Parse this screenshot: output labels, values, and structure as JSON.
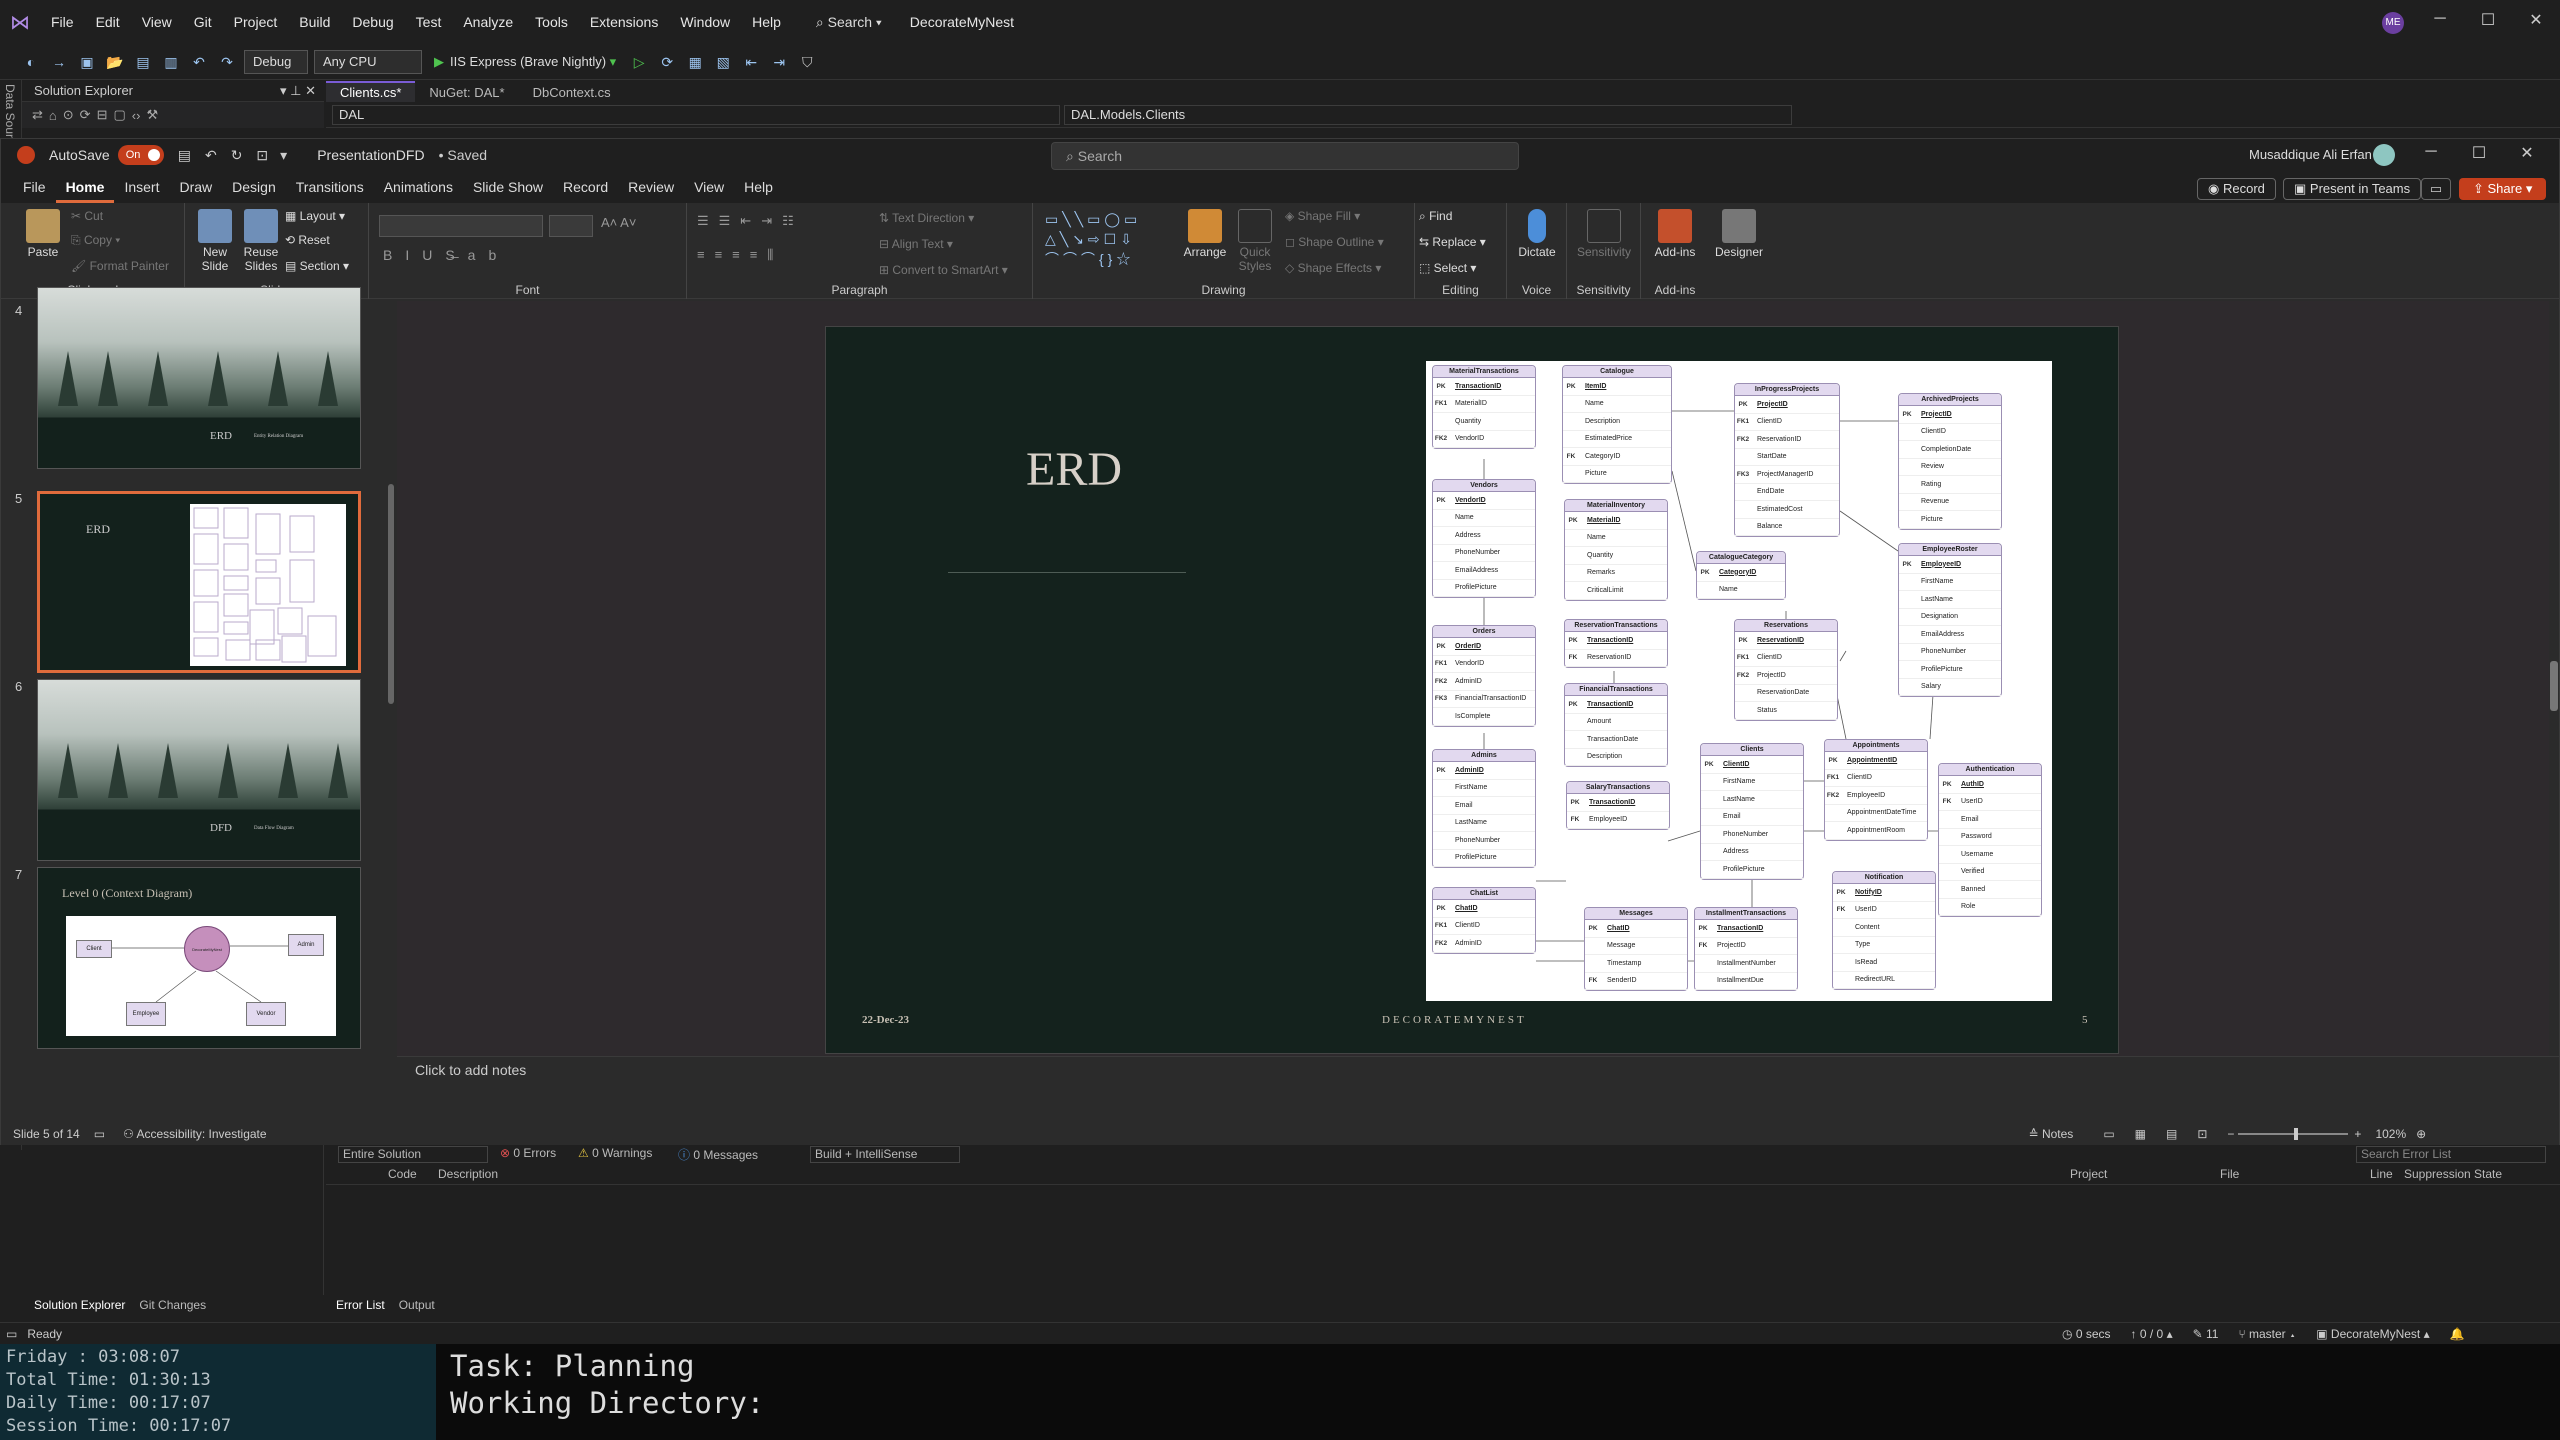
{
  "vs": {
    "menus": [
      "File",
      "Edit",
      "View",
      "Git",
      "Project",
      "Build",
      "Debug",
      "Test",
      "Analyze",
      "Tools",
      "Extensions",
      "Window",
      "Help"
    ],
    "search": "Search",
    "solution_name": "DecorateMyNest",
    "avatar": "ME",
    "config": "Debug",
    "platform": "Any CPU",
    "run_label": "IIS Express (Brave Nightly)",
    "data_sources": "Data Sources",
    "solution_explorer": "Solution Explorer",
    "tabs": [
      "Clients.cs*",
      "NuGet: DAL*",
      "DbContext.cs"
    ],
    "nav_project": "DAL",
    "nav_class": "DAL.Models.Clients",
    "error_scope": "Entire Solution",
    "errors": "0 Errors",
    "warnings": "0 Warnings",
    "messages": "0 Messages",
    "build_filter": "Build + IntelliSense",
    "search_errors": "Search Error List",
    "err_cols": [
      "Code",
      "Description",
      "Project",
      "File",
      "Line",
      "Suppression State"
    ],
    "left_tabs": [
      "Solution Explorer",
      "Git Changes"
    ],
    "right_tabs": [
      "Error List",
      "Output"
    ],
    "status_ready": "Ready",
    "status_secs": "0 secs",
    "status_sync": "0 / 0",
    "status_edits": "11",
    "status_branch": "master",
    "status_repo": "DecorateMyNest"
  },
  "ppt": {
    "autosave": "AutoSave",
    "autosave_state": "On",
    "filename": "PresentationDFD",
    "saved": "• Saved",
    "search": "Search",
    "user": "Musaddique Ali Erfan",
    "tabs": [
      "File",
      "Home",
      "Insert",
      "Draw",
      "Design",
      "Transitions",
      "Animations",
      "Slide Show",
      "Record",
      "Review",
      "View",
      "Help"
    ],
    "record_btn": "Record",
    "teams_btn": "Present in Teams",
    "share_btn": "Share",
    "ribbon": {
      "paste": "Paste",
      "cut": "Cut",
      "copy": "Copy",
      "format_painter": "Format Painter",
      "clipboard": "Clipboard",
      "new_slide": "New Slide",
      "reuse_slides": "Reuse Slides",
      "layout": "Layout",
      "reset": "Reset",
      "section": "Section",
      "slides": "Slides",
      "font": "Font",
      "text_direction": "Text Direction",
      "align_text": "Align Text",
      "convert_smartart": "Convert to SmartArt",
      "paragraph": "Paragraph",
      "arrange": "Arrange",
      "quick_styles": "Quick Styles",
      "shape_fill": "Shape Fill",
      "shape_outline": "Shape Outline",
      "shape_effects": "Shape Effects",
      "drawing": "Drawing",
      "find": "Find",
      "replace": "Replace",
      "select": "Select",
      "editing": "Editing",
      "dictate": "Dictate",
      "voice": "Voice",
      "sensitivity": "Sensitivity",
      "sensitivity_group": "Sensitivity",
      "addins": "Add-ins",
      "addins_group": "Add-ins",
      "designer": "Designer"
    },
    "thumbnails": [
      {
        "num": "4",
        "title": "ERD",
        "subtitle": "Entity Relation Diagram"
      },
      {
        "num": "5",
        "title": "ERD",
        "subtitle": ""
      },
      {
        "num": "6",
        "title": "DFD",
        "subtitle": "Data Flow Diagram"
      },
      {
        "num": "7",
        "title": "Level 0 (Context Diagram)",
        "subtitle": ""
      }
    ],
    "level0": {
      "center": "DecorateMyNest",
      "client": "Client",
      "admin": "Admin",
      "employee": "Employee",
      "vendor": "Vendor"
    },
    "slide": {
      "title": "ERD",
      "date": "22-Dec-23",
      "brand": "DECORATEMYNEST",
      "number": "5"
    },
    "notes": "Click to add notes",
    "status_slide": "Slide 5 of 14",
    "accessibility": "Accessibility: Investigate",
    "notes_btn": "Notes",
    "zoom": "102%"
  },
  "erd": [
    {
      "name": "MaterialTransactions",
      "fields": [
        [
          "PK",
          "TransactionID"
        ],
        [
          "FK1",
          "MaterialID"
        ],
        [
          "",
          "Quantity"
        ],
        [
          "FK2",
          "VendorID"
        ]
      ]
    },
    {
      "name": "Catalogue",
      "fields": [
        [
          "PK",
          "ItemID"
        ],
        [
          "",
          "Name"
        ],
        [
          "",
          "Description"
        ],
        [
          "",
          "EstimatedPrice"
        ],
        [
          "FK",
          "CategoryID"
        ],
        [
          "",
          "Picture"
        ]
      ]
    },
    {
      "name": "InProgressProjects",
      "fields": [
        [
          "PK",
          "ProjectID"
        ],
        [
          "FK1",
          "ClientID"
        ],
        [
          "FK2",
          "ReservationID"
        ],
        [
          "",
          "StartDate"
        ],
        [
          "FK3",
          "ProjectManagerID"
        ],
        [
          "",
          "EndDate"
        ],
        [
          "",
          "EstimatedCost"
        ],
        [
          "",
          "Balance"
        ]
      ]
    },
    {
      "name": "ArchivedProjects",
      "fields": [
        [
          "PK",
          "ProjectID"
        ],
        [
          "",
          "ClientID"
        ],
        [
          "",
          "CompletionDate"
        ],
        [
          "",
          "Review"
        ],
        [
          "",
          "Rating"
        ],
        [
          "",
          "Revenue"
        ],
        [
          "",
          "Picture"
        ]
      ]
    },
    {
      "name": "Vendors",
      "fields": [
        [
          "PK",
          "VendorID"
        ],
        [
          "",
          "Name"
        ],
        [
          "",
          "Address"
        ],
        [
          "",
          "PhoneNumber"
        ],
        [
          "",
          "EmailAddress"
        ],
        [
          "",
          "ProfilePicture"
        ]
      ]
    },
    {
      "name": "MaterialInventory",
      "fields": [
        [
          "PK",
          "MaterialID"
        ],
        [
          "",
          "Name"
        ],
        [
          "",
          "Quantity"
        ],
        [
          "",
          "Remarks"
        ],
        [
          "",
          "CriticalLimit"
        ]
      ]
    },
    {
      "name": "CatalogueCategory",
      "fields": [
        [
          "PK",
          "CategoryID"
        ],
        [
          "",
          "Name"
        ]
      ]
    },
    {
      "name": "EmployeeRoster",
      "fields": [
        [
          "PK",
          "EmployeeID"
        ],
        [
          "",
          "FirstName"
        ],
        [
          "",
          "LastName"
        ],
        [
          "",
          "Designation"
        ],
        [
          "",
          "EmailAddress"
        ],
        [
          "",
          "PhoneNumber"
        ],
        [
          "",
          "ProfilePicture"
        ],
        [
          "",
          "Salary"
        ]
      ]
    },
    {
      "name": "Orders",
      "fields": [
        [
          "PK",
          "OrderID"
        ],
        [
          "FK1",
          "VendorID"
        ],
        [
          "FK2",
          "AdminID"
        ],
        [
          "FK3",
          "FinancialTransactionID"
        ],
        [
          "",
          "IsComplete"
        ]
      ]
    },
    {
      "name": "ReservationTransactions",
      "fields": [
        [
          "PK",
          "TransactionID"
        ],
        [
          "FK",
          "ReservationID"
        ]
      ]
    },
    {
      "name": "Reservations",
      "fields": [
        [
          "PK",
          "ReservationID"
        ],
        [
          "FK1",
          "ClientID"
        ],
        [
          "FK2",
          "ProjectID"
        ],
        [
          "",
          "ReservationDate"
        ],
        [
          "",
          "Status"
        ]
      ]
    },
    {
      "name": "FinancialTransactions",
      "fields": [
        [
          "PK",
          "TransactionID"
        ],
        [
          "",
          "Amount"
        ],
        [
          "",
          "TransactionDate"
        ],
        [
          "",
          "Description"
        ]
      ]
    },
    {
      "name": "Appointments",
      "fields": [
        [
          "PK",
          "AppointmentID"
        ],
        [
          "FK1",
          "ClientID"
        ],
        [
          "FK2",
          "EmployeeID"
        ],
        [
          "",
          "AppointmentDateTime"
        ],
        [
          "",
          "AppointmentRoom"
        ]
      ]
    },
    {
      "name": "Admins",
      "fields": [
        [
          "PK",
          "AdminID"
        ],
        [
          "",
          "FirstName"
        ],
        [
          "",
          "Email"
        ],
        [
          "",
          "LastName"
        ],
        [
          "",
          "PhoneNumber"
        ],
        [
          "",
          "ProfilePicture"
        ]
      ]
    },
    {
      "name": "Clients",
      "fields": [
        [
          "PK",
          "ClientID"
        ],
        [
          "",
          "FirstName"
        ],
        [
          "",
          "LastName"
        ],
        [
          "",
          "Email"
        ],
        [
          "",
          "PhoneNumber"
        ],
        [
          "",
          "Address"
        ],
        [
          "",
          "ProfilePicture"
        ]
      ]
    },
    {
      "name": "SalaryTransactions",
      "fields": [
        [
          "PK",
          "TransactionID"
        ],
        [
          "FK",
          "EmployeeID"
        ]
      ]
    },
    {
      "name": "Authentication",
      "fields": [
        [
          "PK",
          "AuthID"
        ],
        [
          "FK",
          "UserID"
        ],
        [
          "",
          "Email"
        ],
        [
          "",
          "Password"
        ],
        [
          "",
          "Username"
        ],
        [
          "",
          "Verified"
        ],
        [
          "",
          "Banned"
        ],
        [
          "",
          "Role"
        ]
      ]
    },
    {
      "name": "ChatList",
      "fields": [
        [
          "PK",
          "ChatID"
        ],
        [
          "FK1",
          "ClientID"
        ],
        [
          "FK2",
          "AdminID"
        ]
      ]
    },
    {
      "name": "Messages",
      "fields": [
        [
          "PK",
          "ChatID"
        ],
        [
          "",
          "Message"
        ],
        [
          "",
          "Timestamp"
        ],
        [
          "FK",
          "SenderID"
        ]
      ]
    },
    {
      "name": "InstallmentTransactions",
      "fields": [
        [
          "PK",
          "TransactionID"
        ],
        [
          "FK",
          "ProjectID"
        ],
        [
          "",
          "InstallmentNumber"
        ],
        [
          "",
          "InstallmentDue"
        ]
      ]
    },
    {
      "name": "Notification",
      "fields": [
        [
          "PK",
          "NotifyID"
        ],
        [
          "FK",
          "UserID"
        ],
        [
          "",
          "Content"
        ],
        [
          "",
          "Type"
        ],
        [
          "",
          "IsRead"
        ],
        [
          "",
          "RedirectURL"
        ]
      ]
    }
  ],
  "terminal": {
    "day": "Friday  : 03:08:07",
    "total": "Total Time: 01:30:13",
    "daily": "Daily Time: 00:17:07",
    "session": "Session Time: 00:17:07",
    "task": "Task: Planning",
    "workdir": "Working Directory:"
  }
}
